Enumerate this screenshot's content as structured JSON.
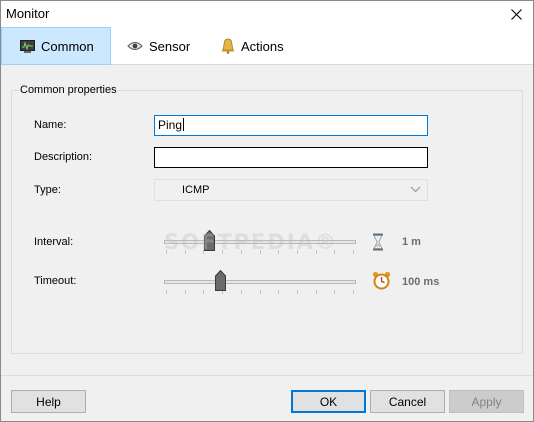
{
  "window": {
    "title": "Monitor"
  },
  "tabs": [
    {
      "label": "Common",
      "icon": "monitor-icon",
      "active": true
    },
    {
      "label": "Sensor",
      "icon": "eye-icon",
      "active": false
    },
    {
      "label": "Actions",
      "icon": "bell-icon",
      "active": false
    }
  ],
  "group": {
    "title": "Common properties"
  },
  "form": {
    "name_label": "Name:",
    "name_value": "Ping",
    "description_label": "Description:",
    "description_value": "",
    "type_label": "Type:",
    "type_value": "ICMP",
    "interval_label": "Interval:",
    "interval_value": "1 m",
    "interval_level": 0.22,
    "timeout_label": "Timeout:",
    "timeout_value": "100 ms",
    "timeout_level": 0.28
  },
  "watermark": "SOFTPEDIA®",
  "buttons": {
    "help": "Help",
    "ok": "OK",
    "cancel": "Cancel",
    "apply": "Apply"
  },
  "colors": {
    "active_tab_bg": "#cce8ff",
    "focus_border": "#0078d7",
    "value_text": "#6d6d6d"
  }
}
